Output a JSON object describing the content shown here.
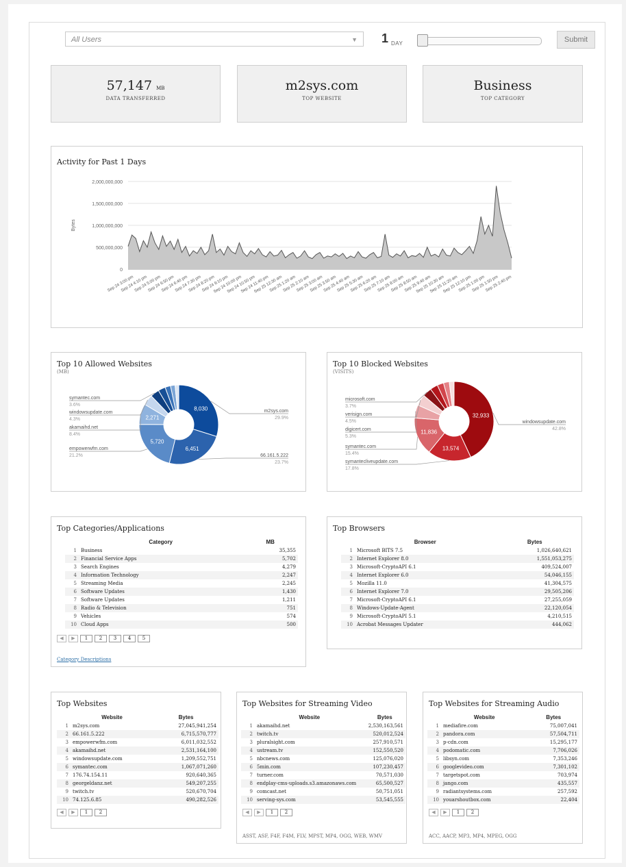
{
  "filters": {
    "user_select": "All Users",
    "day_value": "1",
    "day_unit": "DAY",
    "slider_value": 1,
    "submit_label": "Submit"
  },
  "kpis": [
    {
      "value": "57,147",
      "unit": "MB",
      "label": "DATA TRANSFERRED"
    },
    {
      "value": "m2sys.com",
      "unit": "",
      "label": "TOP WEBSITE"
    },
    {
      "value": "Business",
      "unit": "",
      "label": "TOP CATEGORY"
    }
  ],
  "activity": {
    "title": "Activity for Past 1 Days",
    "chart_data": {
      "type": "area",
      "ylabel": "Bytes",
      "ylim": [
        0,
        2000000000
      ],
      "yticks": [
        "2,000,000,000",
        "1,500,000,000",
        "1,000,000,000",
        "500,000,000",
        "0"
      ],
      "xticks": [
        "Sep 24 3:00 pm",
        "Sep 24 4:10 pm",
        "Sep 24 5:00 pm",
        "Sep 24 6:50 pm",
        "Sep 24 6:40 pm",
        "Sep 24 7:30 pm",
        "Sep 24 8:20 pm",
        "Sep 24 9:10 pm",
        "Sep 24 10:00 pm",
        "Sep 24 10:50 pm",
        "Sep 24 11:40 pm",
        "Sep 25 12:30 am",
        "Sep 25 1:20 am",
        "Sep 25 2:10 am",
        "Sep 25 3:00 am",
        "Sep 25 3:50 am",
        "Sep 25 4:40 am",
        "Sep 25 5:30 am",
        "Sep 25 6:20 am",
        "Sep 25 7:10 am",
        "Sep 25 8:00 am",
        "Sep 25 8:50 am",
        "Sep 25 9:40 am",
        "Sep 25 10:30 am",
        "Sep 25 11:20 am",
        "Sep 25 12:10 pm",
        "Sep 25 1:00 pm",
        "Sep 25 1:50 pm",
        "Sep 25 2:40 pm"
      ],
      "values": [
        520000000,
        780000000,
        700000000,
        400000000,
        650000000,
        500000000,
        850000000,
        600000000,
        450000000,
        760000000,
        520000000,
        640000000,
        450000000,
        680000000,
        380000000,
        520000000,
        300000000,
        420000000,
        360000000,
        500000000,
        330000000,
        420000000,
        800000000,
        380000000,
        460000000,
        320000000,
        520000000,
        400000000,
        350000000,
        600000000,
        380000000,
        290000000,
        420000000,
        350000000,
        470000000,
        330000000,
        280000000,
        400000000,
        300000000,
        320000000,
        430000000,
        260000000,
        330000000,
        380000000,
        250000000,
        300000000,
        420000000,
        280000000,
        240000000,
        330000000,
        380000000,
        250000000,
        300000000,
        280000000,
        350000000,
        290000000,
        360000000,
        240000000,
        300000000,
        260000000,
        400000000,
        280000000,
        250000000,
        330000000,
        380000000,
        260000000,
        290000000,
        800000000,
        320000000,
        270000000,
        350000000,
        300000000,
        420000000,
        260000000,
        310000000,
        290000000,
        360000000,
        270000000,
        500000000,
        300000000,
        340000000,
        280000000,
        460000000,
        320000000,
        300000000,
        480000000,
        380000000,
        330000000,
        420000000,
        520000000,
        360000000,
        650000000,
        1200000000,
        800000000,
        1000000000,
        750000000,
        1900000000,
        1300000000,
        900000000,
        600000000,
        250000000
      ]
    }
  },
  "allowed": {
    "title": "Top 10 Allowed Websites",
    "subtitle": "(MB)",
    "chart_data": {
      "type": "pie",
      "slices": [
        {
          "label": "m2sys.com",
          "pct": "29.9%",
          "value": 8030,
          "value_label": "8,030",
          "color": "#0d4b9c"
        },
        {
          "label": "66.161.5.222",
          "pct": "23.7%",
          "value": 6451,
          "value_label": "6,451",
          "color": "#2c63ad"
        },
        {
          "label": "empowerwfm.com",
          "pct": "21.2%",
          "value": 5720,
          "value_label": "5,720",
          "color": "#5a8bc8"
        },
        {
          "label": "akamaihd.net",
          "pct": "8.4%",
          "value": 2271,
          "value_label": "2,271",
          "color": "#8fb3de"
        },
        {
          "label": "windowsupdate.com",
          "pct": "4.3%",
          "value": 1160,
          "value_label": "",
          "color": "#c5d7ee"
        },
        {
          "label": "symantec.com",
          "pct": "3.6%",
          "value": 970,
          "value_label": "",
          "color": "#0e3f80"
        },
        {
          "label": "",
          "pct": "",
          "value": 800,
          "value_label": "",
          "color": "#174f96"
        },
        {
          "label": "",
          "pct": "",
          "value": 600,
          "value_label": "",
          "color": "#3a73b8"
        },
        {
          "label": "",
          "pct": "",
          "value": 500,
          "value_label": "",
          "color": "#7ba5d6"
        },
        {
          "label": "",
          "pct": "",
          "value": 400,
          "value_label": "",
          "color": "#dbe6f4"
        }
      ]
    }
  },
  "blocked": {
    "title": "Top 10 Blocked Websites",
    "subtitle": "(VISITS)",
    "chart_data": {
      "type": "pie",
      "slices": [
        {
          "label": "windowsupdate.com",
          "pct": "42.8%",
          "value": 32933,
          "value_label": "32,933",
          "color": "#9e0b0f"
        },
        {
          "label": "symantecliveupdate.com",
          "pct": "17.8%",
          "value": 13574,
          "value_label": "13,574",
          "color": "#c7262d"
        },
        {
          "label": "symantec.com",
          "pct": "15.4%",
          "value": 11836,
          "value_label": "11,836",
          "color": "#d9656a"
        },
        {
          "label": "digicert.com",
          "pct": "5.3%",
          "value": 4080,
          "value_label": "",
          "color": "#e8a2a5"
        },
        {
          "label": "verisign.com",
          "pct": "4.5%",
          "value": 3460,
          "value_label": "",
          "color": "#f3cfd0"
        },
        {
          "label": "microsoft.com",
          "pct": "3.7%",
          "value": 2850,
          "value_label": "",
          "color": "#8a1216"
        },
        {
          "label": "",
          "pct": "",
          "value": 2400,
          "value_label": "",
          "color": "#b3161c"
        },
        {
          "label": "",
          "pct": "",
          "value": 2000,
          "value_label": "",
          "color": "#d2454b"
        },
        {
          "label": "",
          "pct": "",
          "value": 1800,
          "value_label": "",
          "color": "#e58186"
        },
        {
          "label": "",
          "pct": "",
          "value": 1500,
          "value_label": "",
          "color": "#f6dedf"
        }
      ]
    }
  },
  "categories": {
    "title": "Top Categories/Applications",
    "col1": "Category",
    "col2": "MB",
    "rows": [
      {
        "n": "1",
        "name": "Business",
        "val": "35,355"
      },
      {
        "n": "2",
        "name": "Financial Service Apps",
        "val": "5,702"
      },
      {
        "n": "3",
        "name": "Search Engines",
        "val": "4,279"
      },
      {
        "n": "4",
        "name": "Information Technology",
        "val": "2,247"
      },
      {
        "n": "5",
        "name": "Streaming Media",
        "val": "2,245"
      },
      {
        "n": "6",
        "name": "Software Updates",
        "val": "1,430"
      },
      {
        "n": "7",
        "name": "Software Updates",
        "val": "1,211"
      },
      {
        "n": "8",
        "name": "Radio & Television",
        "val": "751"
      },
      {
        "n": "9",
        "name": "Vehicles",
        "val": "574"
      },
      {
        "n": "10",
        "name": "Cloud Apps",
        "val": "500"
      }
    ],
    "pages": [
      "1",
      "2",
      "3",
      "4",
      "5"
    ],
    "link": "Category Descriptions"
  },
  "browsers": {
    "title": "Top Browsers",
    "col1": "Browser",
    "col2": "Bytes",
    "rows": [
      {
        "n": "1",
        "name": "Microsoft BITS 7.5",
        "val": "1,026,640,621"
      },
      {
        "n": "2",
        "name": "Internet Explorer 8.0",
        "val": "1,551,053,275"
      },
      {
        "n": "3",
        "name": "Microsoft-CryptoAPI 6.1",
        "val": "409,524,007"
      },
      {
        "n": "4",
        "name": "Internet Explorer 6.0",
        "val": "54,046,155"
      },
      {
        "n": "5",
        "name": "Mozilla 11.0",
        "val": "41,304,575"
      },
      {
        "n": "6",
        "name": "Internet Explorer 7.0",
        "val": "29,505,206"
      },
      {
        "n": "7",
        "name": "Microsoft-CryptoAPI 6.1",
        "val": "27,255,059"
      },
      {
        "n": "8",
        "name": "Windows-Update-Agent",
        "val": "22,120,054"
      },
      {
        "n": "9",
        "name": "Microsoft-CryptoAPI 5.1",
        "val": "4,210,515"
      },
      {
        "n": "10",
        "name": "Acrobat Messages Updater",
        "val": "444,062"
      }
    ]
  },
  "websites": {
    "title": "Top Websites",
    "col1": "Website",
    "col2": "Bytes",
    "rows": [
      {
        "n": "1",
        "name": "m2sys.com",
        "val": "27,045,941,254"
      },
      {
        "n": "2",
        "name": "66.161.5.222",
        "val": "6,715,570,777"
      },
      {
        "n": "3",
        "name": "empowerwfm.com",
        "val": "6,011,032,552"
      },
      {
        "n": "4",
        "name": "akamaihd.net",
        "val": "2,531,164,100"
      },
      {
        "n": "5",
        "name": "windowsupdate.com",
        "val": "1,209,552,751"
      },
      {
        "n": "6",
        "name": "symantec.com",
        "val": "1,067,071,260"
      },
      {
        "n": "7",
        "name": "176.74.154.11",
        "val": "920,640,365"
      },
      {
        "n": "8",
        "name": "georgeldanz.net",
        "val": "549,207,255"
      },
      {
        "n": "9",
        "name": "twitch.tv",
        "val": "520,670,704"
      },
      {
        "n": "10",
        "name": "74.125.6.85",
        "val": "490,282,526"
      }
    ],
    "pages": [
      "1",
      "2"
    ]
  },
  "video": {
    "title": "Top Websites for Streaming Video",
    "col1": "Website",
    "col2": "Bytes",
    "rows": [
      {
        "n": "1",
        "name": "akamaihd.net",
        "val": "2,530,163,561"
      },
      {
        "n": "2",
        "name": "twitch.tv",
        "val": "520,012,524"
      },
      {
        "n": "3",
        "name": "pluralsight.com",
        "val": "257,910,571"
      },
      {
        "n": "4",
        "name": "ustream.tv",
        "val": "152,550,520"
      },
      {
        "n": "5",
        "name": "nbcnews.com",
        "val": "125,076,020"
      },
      {
        "n": "6",
        "name": "5min.com",
        "val": "107,230,457"
      },
      {
        "n": "7",
        "name": "turner.com",
        "val": "70,571,030"
      },
      {
        "n": "8",
        "name": "endplay-cms-uploads.s3.amazonaws.com",
        "val": "65,500,527"
      },
      {
        "n": "9",
        "name": "comcast.net",
        "val": "50,751,051"
      },
      {
        "n": "10",
        "name": "serving-sys.com",
        "val": "53,545,555"
      }
    ],
    "pages": [
      "1",
      "2"
    ],
    "formats": "ASST, ASF, F4F, F4M, FLV, MPST, MP4, OGG, WEB, WMV"
  },
  "audio": {
    "title": "Top Websites for Streaming Audio",
    "col1": "Website",
    "col2": "Bytes",
    "rows": [
      {
        "n": "1",
        "name": "mediafire.com",
        "val": "75,007,041"
      },
      {
        "n": "2",
        "name": "pandora.com",
        "val": "57,504,711"
      },
      {
        "n": "3",
        "name": "p-cdn.com",
        "val": "15,295,177"
      },
      {
        "n": "4",
        "name": "podomatic.com",
        "val": "7,706,026"
      },
      {
        "n": "5",
        "name": "libsyn.com",
        "val": "7,353,246"
      },
      {
        "n": "6",
        "name": "googlevideo.com",
        "val": "7,301,102"
      },
      {
        "n": "7",
        "name": "targetspot.com",
        "val": "703,974"
      },
      {
        "n": "8",
        "name": "jango.com",
        "val": "435,557"
      },
      {
        "n": "9",
        "name": "radiantsystems.com",
        "val": "257,592"
      },
      {
        "n": "10",
        "name": "youarshoutbox.com",
        "val": "22,404"
      }
    ],
    "pages": [
      "1",
      "2"
    ],
    "formats": "ACC, AACP, MP3, MP4, MPEG, OGG"
  }
}
